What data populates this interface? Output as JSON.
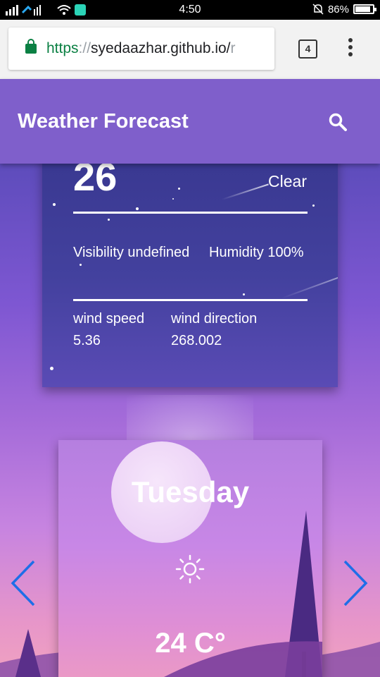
{
  "status_bar": {
    "time": "4:50",
    "battery_percent_label": "86%",
    "battery_level": 0.86
  },
  "browser": {
    "url_scheme": "https",
    "url_separator": "://",
    "url_host": "syedaazhar.github.io/",
    "url_tail": "r",
    "tab_count": "4",
    "icons": [
      "lock-icon",
      "menu-dots-icon"
    ]
  },
  "app": {
    "title": "Weather Forecast",
    "search_icon": "search-icon",
    "accent_color": "#7f5fcb"
  },
  "current": {
    "temperature": "26",
    "degree_symbol": "°",
    "condition": "Clear",
    "visibility": "Visibility undefined",
    "humidity": "Humidity 100%",
    "wind_speed_label": "wind speed",
    "wind_speed_value": "5.36",
    "wind_direction_label": "wind direction",
    "wind_direction_value": "268.002"
  },
  "forecast": {
    "day": "Tuesday",
    "icon": "sun-icon",
    "temperature": "24 C°"
  },
  "navigation": {
    "prev_icon": "chevron-left-icon",
    "next_icon": "chevron-right-icon",
    "arrow_color": "#1e6ee8"
  }
}
